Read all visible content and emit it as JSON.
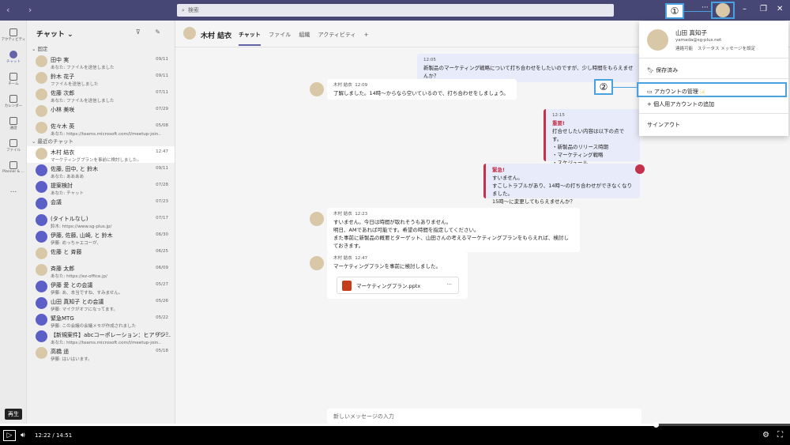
{
  "app": {
    "search_placeholder": "検索"
  },
  "callouts": {
    "one": "①",
    "two": "②"
  },
  "rail": [
    {
      "label": "アクティビティ"
    },
    {
      "label": "チャット"
    },
    {
      "label": "チーム"
    },
    {
      "label": "カレンダー"
    },
    {
      "label": "通話"
    },
    {
      "label": "ファイル"
    },
    {
      "label": "Planner & ..."
    },
    {
      "label": "..."
    }
  ],
  "chatlist": {
    "title": "チャット",
    "pinned_label": "固定",
    "recent_label": "最近のチャット",
    "pinned": [
      {
        "name": "田中 実",
        "preview": "あなた: ファイルを送信しました",
        "date": "09/11"
      },
      {
        "name": "鈴木 花子",
        "preview": "ファイルを送信しました",
        "date": "09/11"
      },
      {
        "name": "佐藤 次郎",
        "preview": "あなた: ファイルを送信しました",
        "date": "07/11"
      },
      {
        "name": "小林 美咲",
        "preview": "",
        "date": "07/29"
      },
      {
        "name": "佐々木 英",
        "preview": "あなた: https://teams.microsoft.com/l/meetup-join...",
        "date": "05/08"
      }
    ],
    "recent": [
      {
        "name": "木村 結衣",
        "preview": "マーケティングプランを事前に検討しました。",
        "date": "12:47",
        "active": true
      },
      {
        "name": "佐藤, 田中, と 鈴木",
        "preview": "あなた: ああああ",
        "date": "09/11"
      },
      {
        "name": "提案検討",
        "preview": "あなた: チャット",
        "date": "07/28"
      },
      {
        "name": "会議",
        "preview": "",
        "date": "07/23"
      },
      {
        "name": "(タイトルなし)",
        "preview": "鈴木: https://www.sg-plus.jp/",
        "date": "07/17"
      },
      {
        "name": "伊藤, 佐藤, 山崎, と 鈴木",
        "preview": "伊藤: めっちゃエコーが、",
        "date": "06/30"
      },
      {
        "name": "佐藤 と 斉藤",
        "preview": "",
        "date": "06/25"
      },
      {
        "name": "斉藤 太郎",
        "preview": "あなた: https://ez-office.jp/",
        "date": "06/09"
      },
      {
        "name": "伊藤 愛 との会議",
        "preview": "伊藤: あ、本当ですね、すみません。",
        "date": "05/27"
      },
      {
        "name": "山田 真知子 との会議",
        "preview": "伊藤: マイクがオフになってます。",
        "date": "05/26"
      },
      {
        "name": "緊急MTG",
        "preview": "伊藤: この会議の会議メモが作成されました",
        "date": "05/22"
      },
      {
        "name": "【新規案件】abcコーポレーション：ヒアリン...",
        "preview": "あなた: https://teams.microsoft.com/l/meetup-join...",
        "date": "05/19"
      },
      {
        "name": "高橋 遥",
        "preview": "伊藤: はいはいます。",
        "date": "05/18"
      }
    ]
  },
  "conversation": {
    "name": "木村 結衣",
    "tabs": [
      "チャット",
      "ファイル",
      "組織",
      "アクティビティ"
    ],
    "add_tab": "+",
    "messages": [
      {
        "time": "12:05",
        "text": "新製品のマーケティング戦略について打ち合わせをしたいのですが、少し時間をもらえませんか？"
      },
      {
        "author": "木村 結衣",
        "time": "12:09",
        "text": "了解しました。14時～からなら空いているので、打ち合わせをしましょう。"
      },
      {
        "time": "12:15",
        "label": "重要!",
        "lines": [
          "打合せしたい内容は以下の点です。",
          "・新製品のリリース時期",
          "・マーケティング戦略",
          "・スケジュール"
        ]
      },
      {
        "label": "緊急!",
        "lines": [
          "すいません。",
          "すこしトラブルがあり、14時～の打ち合わせができなくなりました。",
          "15時～に変更してもらえませんか？"
        ]
      },
      {
        "author": "木村 結衣",
        "time": "12:23",
        "lines": [
          "すいません。今日は時間が取れそうもありません。",
          "明日、AMであれば可能です。希望の時間を指定してください。",
          "また事前に新製品の概要とターゲット、山田さんの考えるマーケティングプランをもらえれば、検討しておきます。"
        ]
      },
      {
        "author": "木村 結衣",
        "time": "12:47",
        "text": "マーケティングプランを事前に検討しました。",
        "file": "マーケティングプラン.pptx"
      }
    ],
    "compose_placeholder": "新しいメッセージの入力"
  },
  "account_menu": {
    "name": "山田 真知子",
    "email": "yamada@sg-plus.net",
    "status": "連絡可能",
    "status_msg": "ステータス メッセージを設定",
    "saved": "保存済み",
    "manage": "アカウントの管理",
    "add_personal": "個人用アカウントの追加",
    "signout": "サインアウト"
  },
  "player": {
    "tooltip": "再生",
    "time": "12:22 / 14:51",
    "progress": 0.83
  }
}
